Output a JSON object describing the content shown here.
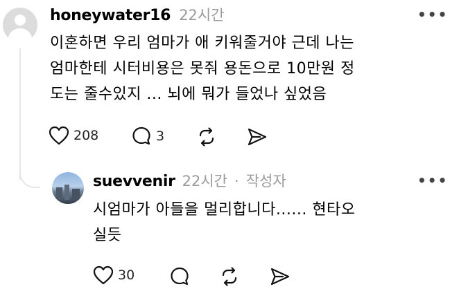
{
  "comment": {
    "username": "honeywater16",
    "time": "22시간",
    "text_line1": "이혼하면 우리 엄마가 애 키워줄거야 근데 나는",
    "text_line2": "엄마한테 시터비용은 못줘 용돈으로 10만원 정",
    "text_line3": "도는 줄수있지 ... 뇌에 뭐가 들었나 싶었음",
    "like_count": "208",
    "reply_count": "3",
    "more": "•••"
  },
  "reply": {
    "username": "suevvenir",
    "time": "22시간",
    "separator": "·",
    "author_tag": "작성자",
    "text_line1": "시엄마가 아들을 멀리합니다...... 현타오",
    "text_line2": "실듯",
    "like_count": "30",
    "more": "•••"
  },
  "icons": [
    "heart-icon",
    "comment-icon",
    "repost-icon",
    "share-icon",
    "more-icon",
    "avatar"
  ]
}
